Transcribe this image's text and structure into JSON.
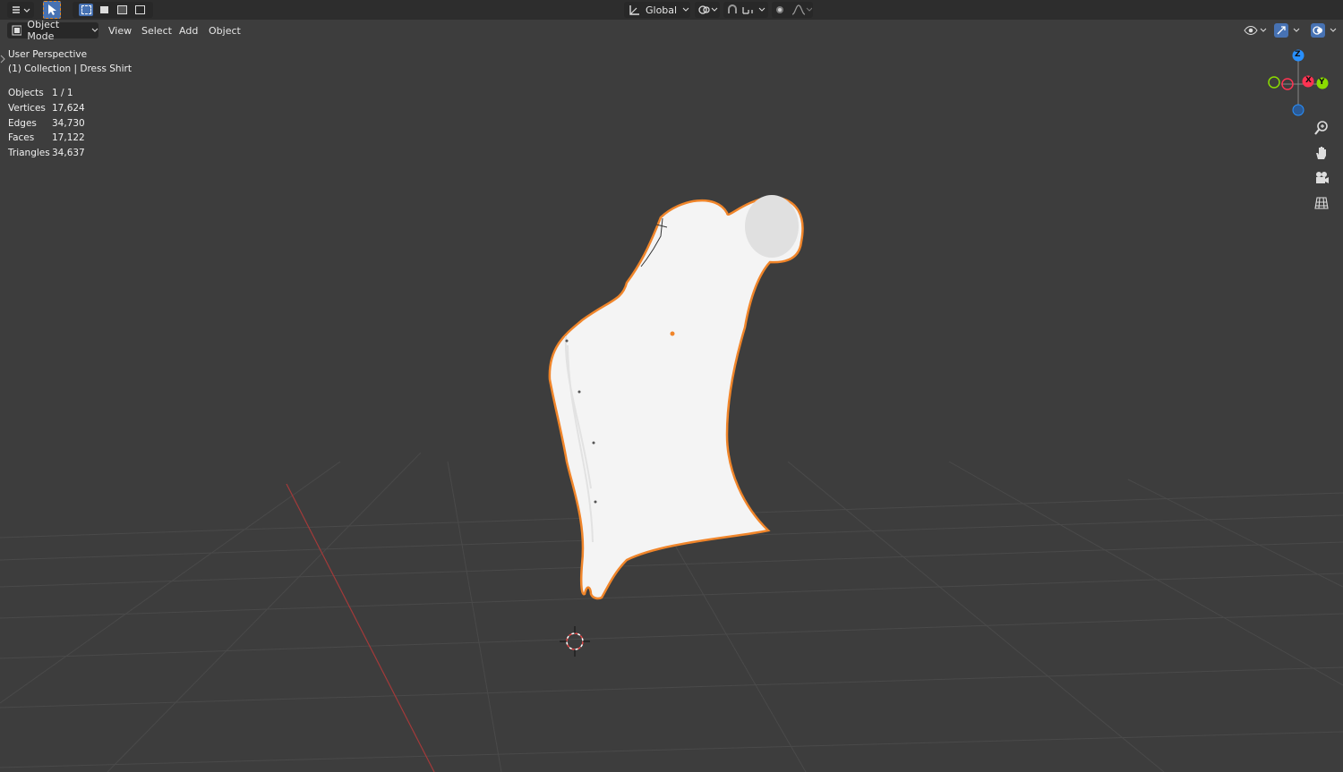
{
  "top_toolbar": {
    "transform_orientation": "Global",
    "editor_type_icon": "editor-type-icon",
    "select_tool_icon": "select-box-icon",
    "select_modes": [
      "mode-new-icon",
      "mode-extend-icon",
      "mode-subtract-icon",
      "mode-intersect-icon"
    ],
    "pivot_icon": "pivot-icon",
    "snap_icon": "snap-magnet-icon",
    "proportional_icon": "proportional-edit-icon"
  },
  "header": {
    "mode": "Object Mode",
    "menus": [
      "View",
      "Select",
      "Add",
      "Object"
    ]
  },
  "overlay_text": {
    "perspective": "User Perspective",
    "collection": "(1) Collection | Dress Shirt"
  },
  "stats": [
    {
      "label": "Objects",
      "value": "1 / 1"
    },
    {
      "label": "Vertices",
      "value": "17,624"
    },
    {
      "label": "Edges",
      "value": "34,730"
    },
    {
      "label": "Faces",
      "value": "17,122"
    },
    {
      "label": "Triangles",
      "value": "34,637"
    }
  ],
  "gizmo": {
    "x": "X",
    "y": "Y",
    "z": "Z",
    "colors": {
      "x": "#ff3352",
      "y": "#8bdc00",
      "z": "#2890ff"
    }
  },
  "nav_buttons": [
    "zoom-icon",
    "pan-hand-icon",
    "camera-icon",
    "grid-view-icon"
  ],
  "colors": {
    "selection_outline": "#f0852a",
    "viewport_bg": "#3d3d3d",
    "x_axis_line": "#a33a3a"
  }
}
